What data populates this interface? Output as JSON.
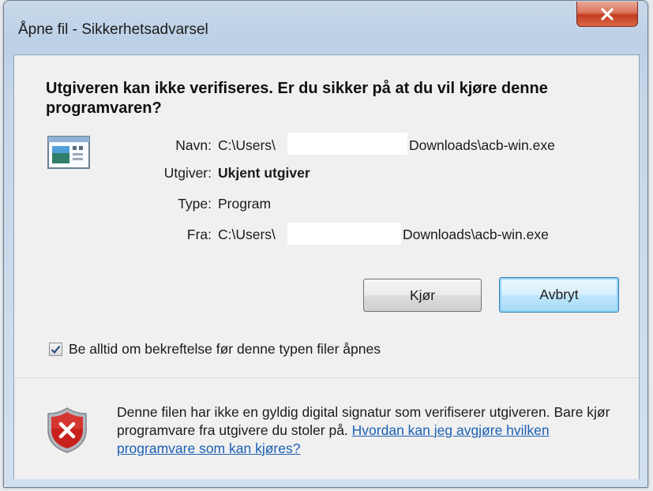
{
  "window": {
    "title": "Åpne fil - Sikkerhetsadvarsel",
    "close_symbol": "X"
  },
  "dialog": {
    "headline": "Utgiveren kan ikke verifiseres. Er du sikker på at du vil kjøre denne programvaren?",
    "icon": "program-icon",
    "fields": {
      "name_label": "Navn:",
      "name_value_prefix": "C:\\Users\\",
      "name_value_suffix": "Downloads\\acb-win.exe",
      "publisher_label": "Utgiver:",
      "publisher_value": "Ukjent utgiver",
      "type_label": "Type:",
      "type_value": "Program",
      "from_label": "Fra:",
      "from_value_prefix": "C:\\Users\\",
      "from_value_suffix": "Downloads\\acb-win.exe"
    },
    "buttons": {
      "run_label": "Kjør",
      "cancel_label": "Avbryt"
    },
    "checkbox": {
      "checked": true,
      "label": "Be alltid om bekreftelse før denne typen filer åpnes"
    },
    "footer": {
      "icon": "shield-warning-icon",
      "text": "Denne filen har ikke en gyldig digital signatur som verifiserer utgiveren. Bare kjør programvare fra utgivere du stoler på. ",
      "link": "Hvordan kan jeg avgjøre hvilken programvare som kan kjøres?"
    }
  },
  "colors": {
    "link": "#1a5fb4",
    "close_button": "#c43c1f",
    "shield": "#c8201d"
  }
}
